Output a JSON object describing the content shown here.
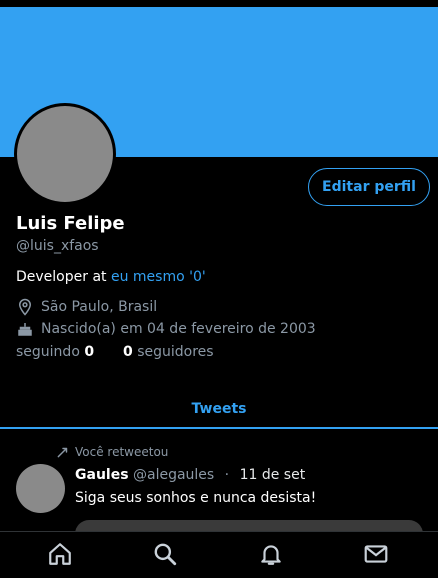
{
  "profile": {
    "name": "Luis Felipe",
    "handle": "@luis_xfaos",
    "edit_label": "Editar perfil",
    "bio_prefix": "Developer at ",
    "bio_link": "eu mesmo '0'",
    "location": "São Paulo, Brasil",
    "birth": "Nascido(a) em 04 de fevereiro de 2003",
    "following_label": "seguindo",
    "following_count": "0",
    "followers_count": "0",
    "followers_label": "seguidores"
  },
  "tabs": {
    "tweets_label": "Tweets"
  },
  "tweet": {
    "retweet_note": "Você retweetou",
    "author": "Gaules",
    "author_handle": "@alegaules",
    "separator": "·",
    "date": "11 de set",
    "text": "Siga seus sonhos e nunca desista!"
  },
  "colors": {
    "accent": "#33a1f2",
    "banner": "#33a1f2",
    "background": "#000000",
    "muted": "#8b98a5"
  },
  "nav": {
    "items": [
      {
        "icon": "home-icon"
      },
      {
        "icon": "search-icon"
      },
      {
        "icon": "bell-icon"
      },
      {
        "icon": "mail-icon"
      }
    ]
  }
}
